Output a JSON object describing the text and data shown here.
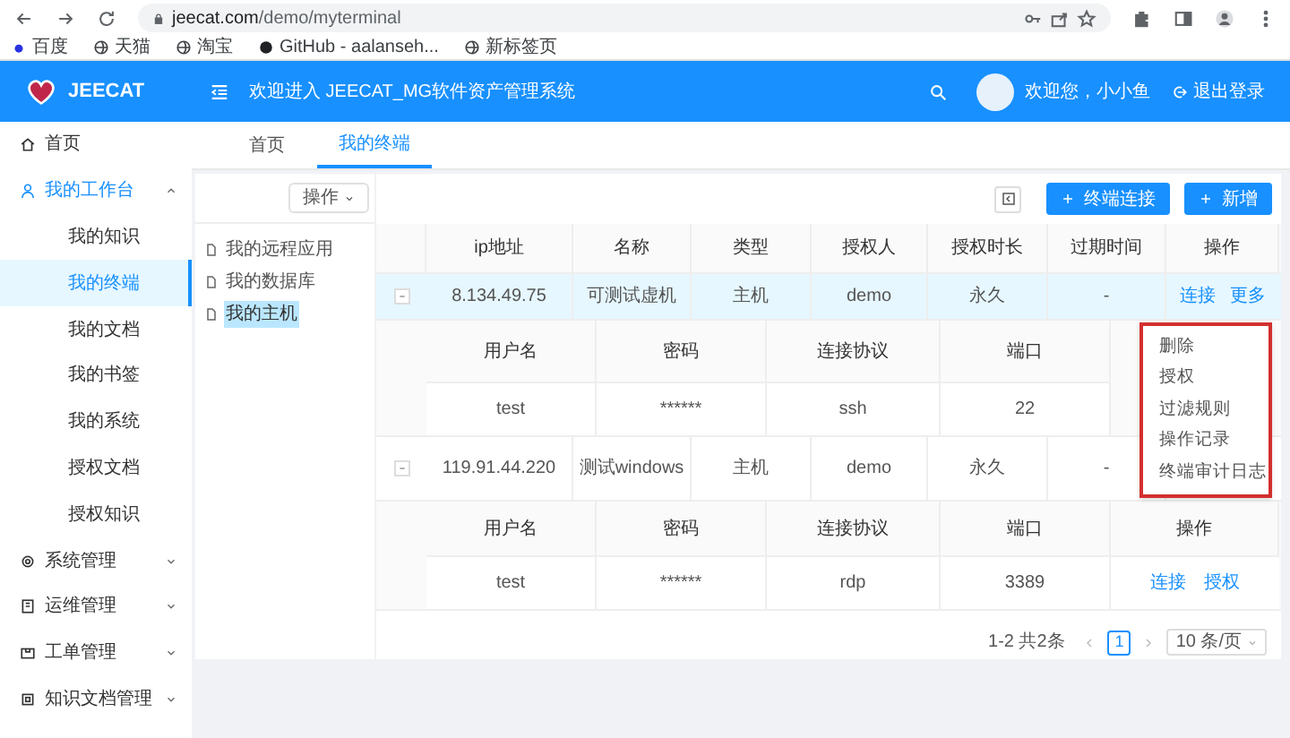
{
  "browser": {
    "url_domain": "jeecat.com",
    "url_path": "/demo/myterminal",
    "bookmarks": [
      "百度",
      "天猫",
      "淘宝",
      "GitHub - aalanseh...",
      "新标签页"
    ]
  },
  "header": {
    "brand": "JEECAT",
    "title": "欢迎进入 JEECAT_MG软件资产管理系统",
    "greeting": "欢迎您，小小鱼",
    "logout": "退出登录"
  },
  "sidebar": {
    "items": [
      {
        "label": "首页",
        "kind": "link"
      },
      {
        "label": "我的工作台",
        "kind": "group",
        "expanded": true,
        "children": [
          {
            "label": "我的知识",
            "selected": false
          },
          {
            "label": "我的终端",
            "selected": true
          },
          {
            "label": "我的文档",
            "selected": false
          },
          {
            "label": "我的书签",
            "selected": false
          },
          {
            "label": "我的系统",
            "selected": false
          },
          {
            "label": "授权文档",
            "selected": false
          },
          {
            "label": "授权知识",
            "selected": false
          }
        ]
      },
      {
        "label": "系统管理",
        "kind": "group",
        "expanded": false
      },
      {
        "label": "运维管理",
        "kind": "group",
        "expanded": false
      },
      {
        "label": "工单管理",
        "kind": "group",
        "expanded": false
      },
      {
        "label": "知识文档管理",
        "kind": "group",
        "expanded": false
      }
    ]
  },
  "tabs": [
    {
      "label": "首页",
      "selected": false
    },
    {
      "label": "我的终端",
      "selected": true
    }
  ],
  "tree": {
    "action": "操作",
    "items": [
      {
        "label": "我的远程应用",
        "selected": false
      },
      {
        "label": "我的数据库",
        "selected": false
      },
      {
        "label": "我的主机",
        "selected": true
      }
    ]
  },
  "toolbar": {
    "buttons": [
      "终端连接",
      "新增"
    ]
  },
  "table": {
    "columns": [
      "ip地址",
      "名称",
      "类型",
      "授权人",
      "授权时长",
      "过期时间",
      "操作"
    ],
    "rows": [
      {
        "cells": [
          "8.134.49.75",
          "可测试虚机",
          "主机",
          "demo",
          "永久",
          "-"
        ],
        "actions": [
          "连接",
          "更多"
        ],
        "expanded": true,
        "selected": true,
        "accounts": {
          "columns": [
            "用户名",
            "密码",
            "连接协议",
            "端口"
          ],
          "rows": [
            {
              "cells": [
                "test",
                "******",
                "ssh",
                "22"
              ],
              "actions": []
            }
          ]
        }
      },
      {
        "cells": [
          "119.91.44.220",
          "测试windows",
          "主机",
          "demo",
          "永久",
          "-"
        ],
        "actions": [],
        "expanded": true,
        "selected": false,
        "accounts": {
          "columns": [
            "用户名",
            "密码",
            "连接协议",
            "端口",
            "操作"
          ],
          "rows": [
            {
              "cells": [
                "test",
                "******",
                "rdp",
                "3389"
              ],
              "actions": [
                "连接",
                "授权"
              ]
            }
          ]
        }
      }
    ]
  },
  "dropdown": {
    "items": [
      "删除",
      "授权",
      "过滤规则",
      "操作记录",
      "终端审计日志"
    ]
  },
  "pagination": {
    "summary": "1-2 共2条",
    "pages": [
      {
        "label": "1",
        "selected": true
      }
    ],
    "page_size": "10 条/页"
  }
}
